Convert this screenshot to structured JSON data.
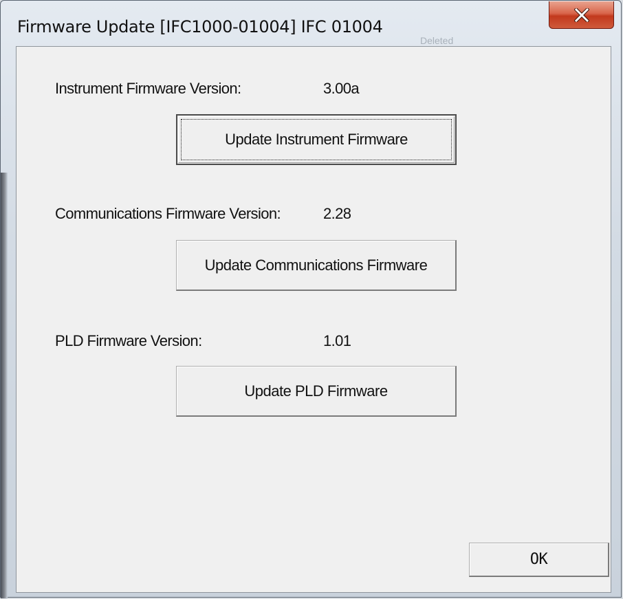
{
  "window": {
    "title": "Firmware Update [IFC1000-01004] IFC 01004",
    "background_title": "Deleted",
    "accent_close": "#c8452a"
  },
  "icons": {
    "close": "close-icon"
  },
  "instrument": {
    "label": "Instrument Firmware Version:",
    "version": "3.00a",
    "button": "Update Instrument Firmware"
  },
  "communications": {
    "label": "Communications Firmware Version:",
    "version": "2.28",
    "button": "Update Communications Firmware"
  },
  "pld": {
    "label": "PLD Firmware Version:",
    "version": "1.01",
    "button": "Update PLD Firmware"
  },
  "footer": {
    "ok": "OK"
  }
}
